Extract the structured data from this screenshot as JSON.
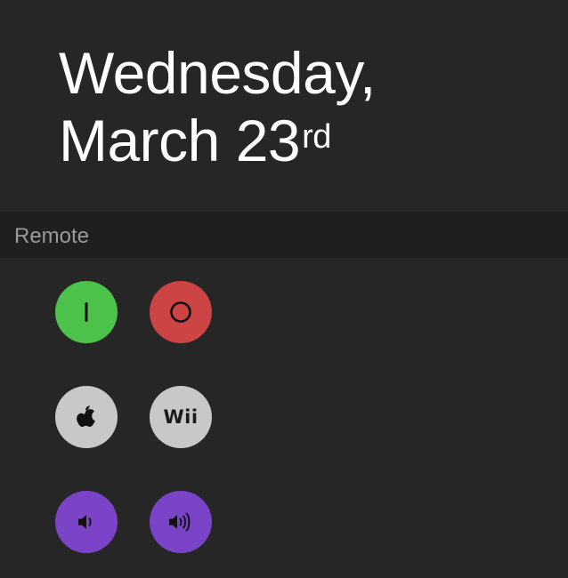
{
  "date": {
    "line1": "Wednesday,",
    "line2": "March 23",
    "suffix": "rd"
  },
  "section": {
    "title": "Remote"
  },
  "buttons": [
    {
      "name": "power-on-button",
      "icon": "power-on-icon",
      "color": "#4cc24b"
    },
    {
      "name": "power-off-button",
      "icon": "power-off-icon",
      "color": "#cc4444"
    },
    {
      "name": "apple-tv-button",
      "icon": "apple-icon",
      "color": "#c8c8c8"
    },
    {
      "name": "wii-button",
      "icon": "wii-icon",
      "label": "Wii",
      "color": "#c8c8c8"
    },
    {
      "name": "volume-down-button",
      "icon": "volume-down-icon",
      "color": "#7b44c8"
    },
    {
      "name": "volume-up-button",
      "icon": "volume-up-icon",
      "color": "#7b44c8"
    }
  ]
}
